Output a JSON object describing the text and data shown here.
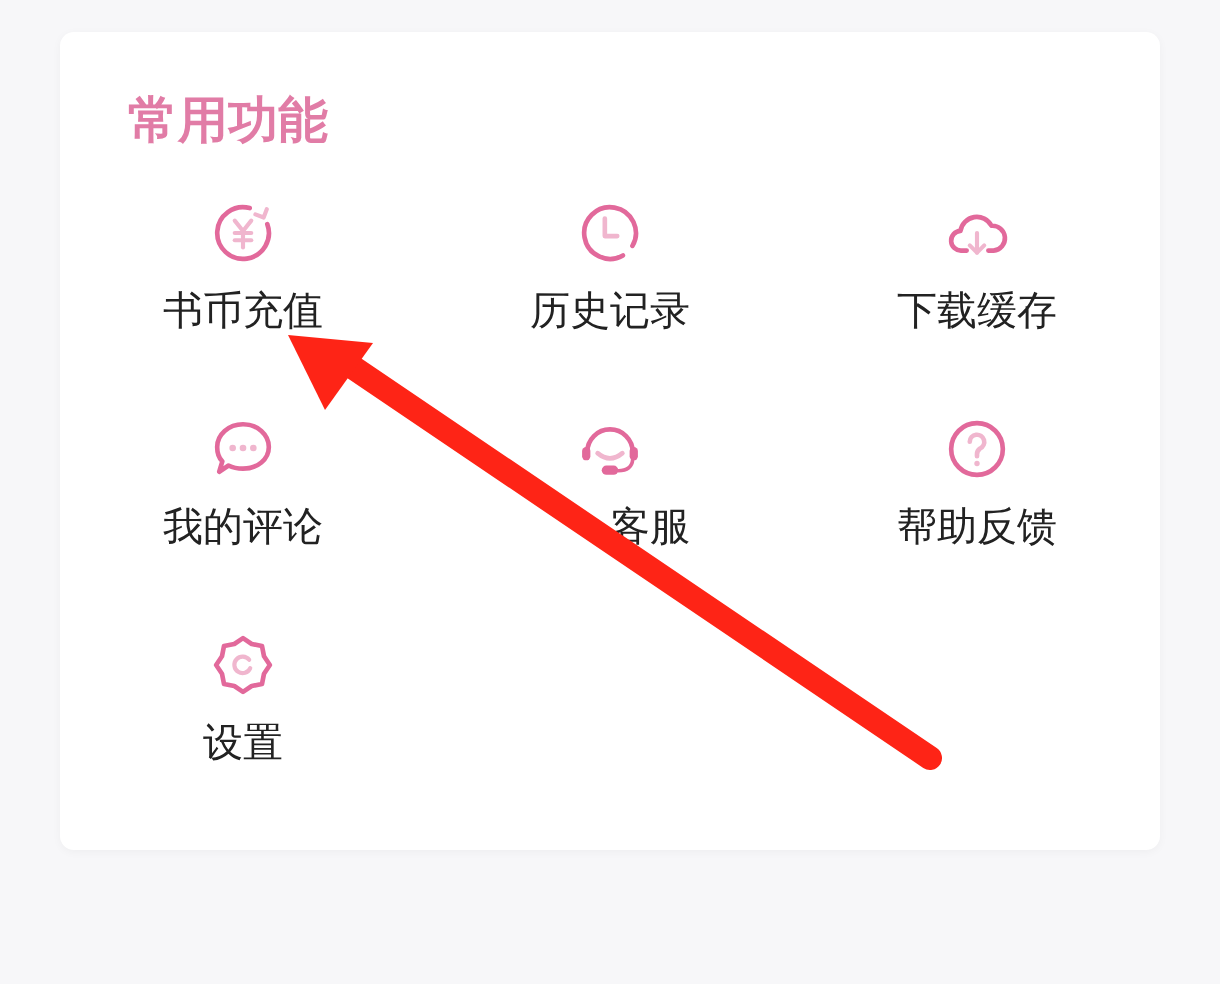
{
  "section": {
    "title": "常用功能",
    "items": [
      {
        "label": "书币充值",
        "covered": false
      },
      {
        "label": "历史记录",
        "covered": false
      },
      {
        "label": "下载缓存",
        "covered": false
      },
      {
        "label": "我的评论",
        "covered": false
      },
      {
        "label": "客服",
        "covered": true
      },
      {
        "label": "帮助反馈",
        "covered": false
      },
      {
        "label": "设置",
        "covered": false
      }
    ]
  }
}
